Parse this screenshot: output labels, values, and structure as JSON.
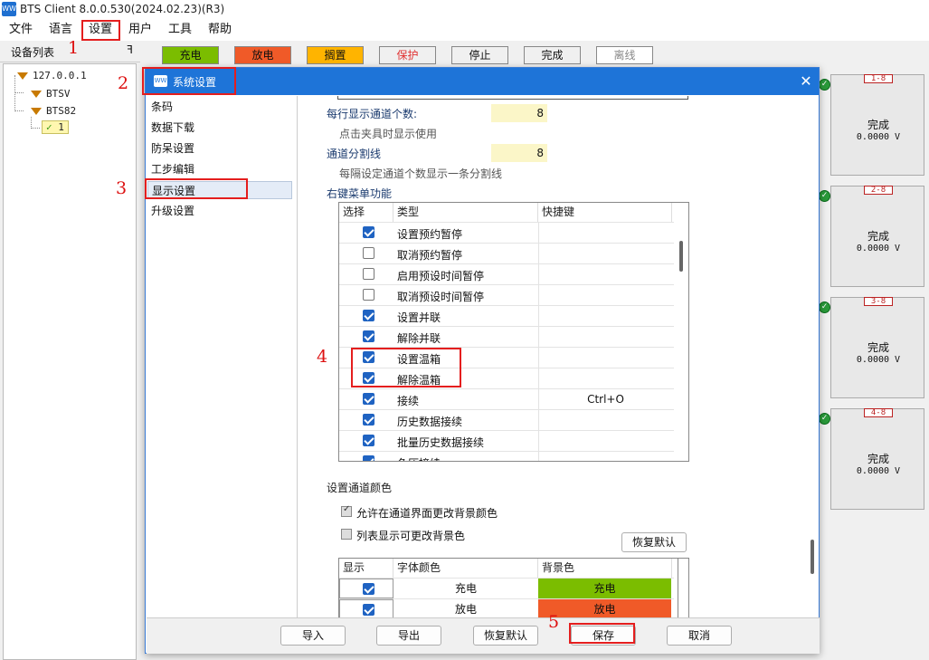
{
  "app": {
    "title": "BTS Client 8.0.0.530(2024.02.23)(R3)",
    "icon": "WW"
  },
  "menu": [
    "文件",
    "语言",
    "设置",
    "用户",
    "工具",
    "帮助"
  ],
  "toolbar": [
    {
      "label": "充电",
      "color": "#7bbd00"
    },
    {
      "label": "放电",
      "color": "#f05a28"
    },
    {
      "label": "搁置",
      "color": "#ffb400"
    },
    {
      "label": "保护",
      "color": "#f0f0f0",
      "text_color": "#e03030"
    },
    {
      "label": "停止",
      "color": "#f0f0f0"
    },
    {
      "label": "完成",
      "color": "#f0f0f0"
    },
    {
      "label": "离线",
      "color": "#ffffff",
      "text_color": "#888888"
    }
  ],
  "device_panel": {
    "title": "设备列表",
    "pin": "ꟻ",
    "nodes": [
      "127.0.0.1",
      "BTSV",
      "BTS82",
      "1"
    ]
  },
  "channels": [
    {
      "id": "1-8",
      "status": "完成",
      "voltage": "0.0000 V"
    },
    {
      "id": "2-8",
      "status": "完成",
      "voltage": "0.0000 V"
    },
    {
      "id": "3-8",
      "status": "完成",
      "voltage": "0.0000 V"
    },
    {
      "id": "4-8",
      "status": "完成",
      "voltage": "0.0000 V"
    }
  ],
  "dialog": {
    "title": "系统设置",
    "close": "✕",
    "nav": [
      "条码",
      "数据下载",
      "防呆设置",
      "工步编辑",
      "显示设置",
      "升级设置"
    ],
    "per_row_label": "每行显示通道个数:",
    "per_row_value": "8",
    "per_row_hint": "点击夹具时显示使用",
    "divider_label": "通道分割线",
    "divider_value": "8",
    "divider_hint": "每隔设定通道个数显示一条分割线",
    "context_menu_label": "右键菜单功能",
    "context_table": {
      "headers": [
        "选择",
        "类型",
        "快捷键"
      ],
      "rows": [
        {
          "checked": true,
          "type": "设置预约暂停",
          "key": ""
        },
        {
          "checked": false,
          "type": "取消预约暂停",
          "key": ""
        },
        {
          "checked": false,
          "type": "启用预设时间暂停",
          "key": ""
        },
        {
          "checked": false,
          "type": "取消预设时间暂停",
          "key": ""
        },
        {
          "checked": true,
          "type": "设置并联",
          "key": ""
        },
        {
          "checked": true,
          "type": "解除并联",
          "key": ""
        },
        {
          "checked": true,
          "type": "设置温箱",
          "key": ""
        },
        {
          "checked": true,
          "type": "解除温箱",
          "key": ""
        },
        {
          "checked": true,
          "type": "接续",
          "key": "Ctrl+O"
        },
        {
          "checked": true,
          "type": "历史数据接续",
          "key": ""
        },
        {
          "checked": true,
          "type": "批量历史数据接续",
          "key": ""
        },
        {
          "checked": true,
          "type": "负压接续",
          "key": ""
        }
      ]
    },
    "color_section_label": "设置通道颜色",
    "allow_bg_label": "允许在通道界面更改背景颜色",
    "list_bg_label": "列表显示可更改背景色",
    "restore_default": "恢复默认",
    "color_table": {
      "headers": [
        "显示",
        "字体颜色",
        "背景色"
      ],
      "rows": [
        {
          "checked": true,
          "font": "充电",
          "bg": "充电",
          "bg_color": "#7bbd00"
        },
        {
          "checked": true,
          "font": "放电",
          "bg": "放电",
          "bg_color": "#f05a28"
        }
      ]
    },
    "footer": [
      "导入",
      "导出",
      "恢复默认",
      "保存",
      "取消"
    ]
  },
  "callouts": [
    "1",
    "2",
    "3",
    "4",
    "5"
  ]
}
